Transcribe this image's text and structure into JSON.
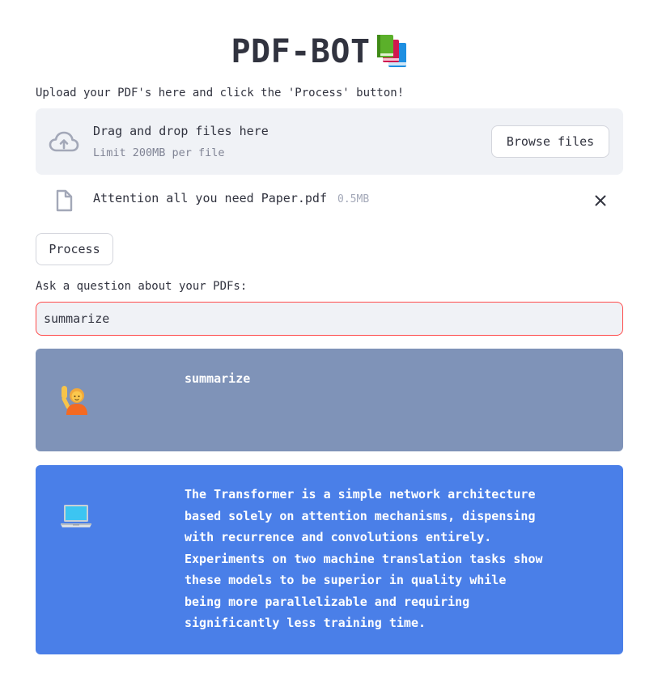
{
  "app": {
    "title": "PDF-BOT",
    "title_icon": "books-icon"
  },
  "upload": {
    "label": "Upload your PDF's here and click the 'Process' button!",
    "dropzone_title": "Drag and drop files here",
    "dropzone_limit": "Limit 200MB per file",
    "browse_label": "Browse files",
    "file": {
      "name": "Attention all you need Paper.pdf",
      "size": "0.5MB"
    }
  },
  "process_label": "Process",
  "question": {
    "label": "Ask a question about your PDFs:",
    "value": "summarize"
  },
  "chat": [
    {
      "role": "user",
      "avatar": "person-raising-hand-icon",
      "text": "summarize"
    },
    {
      "role": "bot",
      "avatar": "laptop-icon",
      "text": "The Transformer is a simple network architecture\nbased solely on attention mechanisms, dispensing\nwith recurrence and convolutions entirely.\nExperiments on two machine translation tasks show\nthese models to be superior in quality while\nbeing more parallelizable and requiring\nsignificantly less training time."
    }
  ],
  "colors": {
    "user_message_bg": "#7f93b8",
    "bot_message_bg": "#4a7fe8",
    "input_focus_border": "#ff4b4b",
    "dropzone_bg": "#f0f2f6"
  }
}
